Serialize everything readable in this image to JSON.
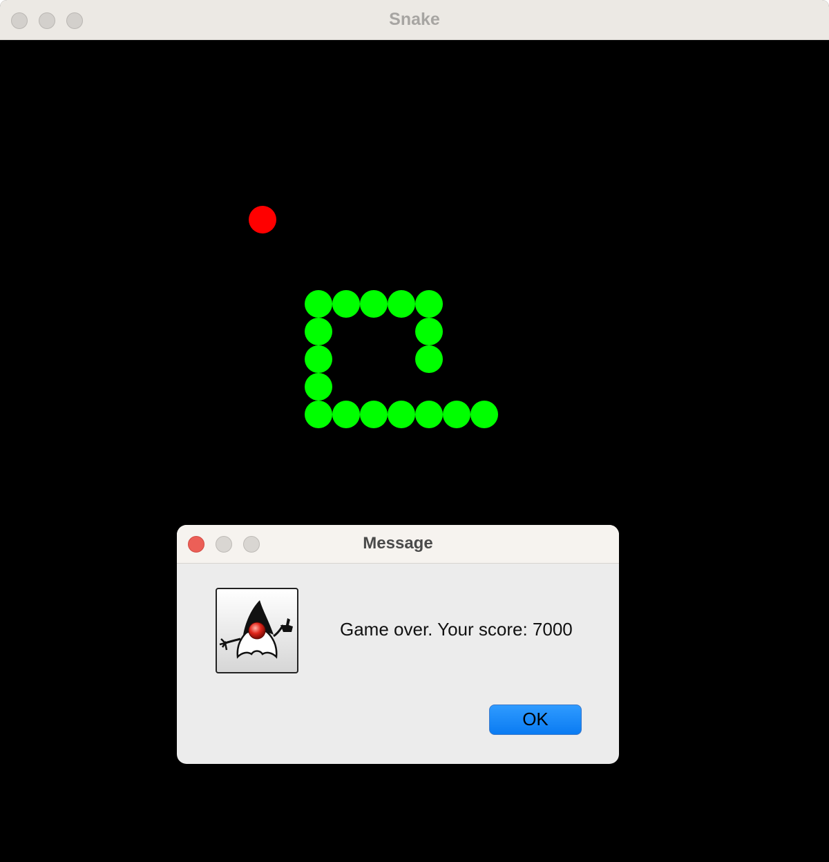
{
  "window": {
    "title": "Snake"
  },
  "game": {
    "snake_color": "#00ff00",
    "food_color": "#ff0000",
    "background_color": "#000000"
  },
  "dialog": {
    "title": "Message",
    "message": "Game over. Your score: 7000",
    "ok_label": "OK",
    "icon": "java-duke-icon"
  }
}
